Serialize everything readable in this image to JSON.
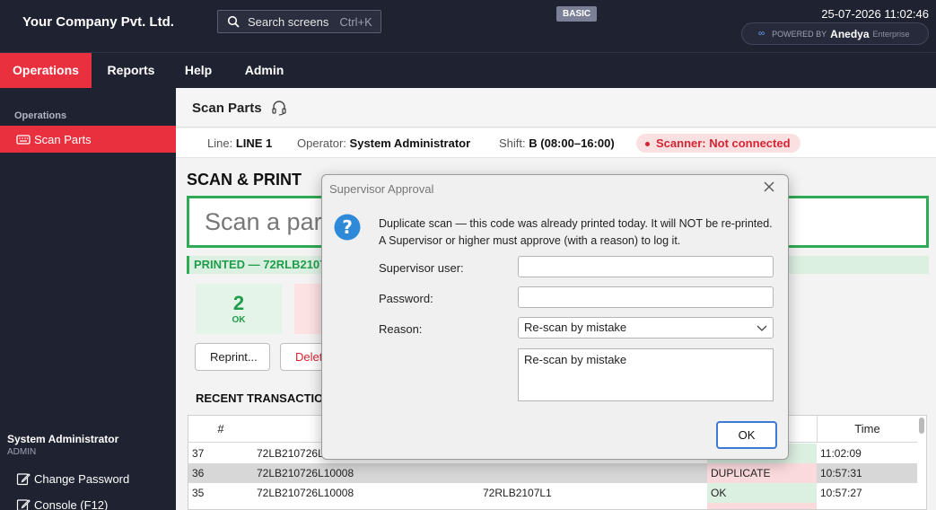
{
  "header": {
    "company": "Your Company Pvt. Ltd.",
    "search_label": "Search screens",
    "search_shortcut": "Ctrl+K",
    "plan_badge": "BASIC",
    "datetime": "25-07-2026 11:02:46",
    "powered_by": "POWERED BY",
    "brand": "Anedya",
    "edition": "Enterprise"
  },
  "menu": {
    "items": [
      "Operations",
      "Reports",
      "Help",
      "Admin"
    ],
    "active": "Operations"
  },
  "sidebar": {
    "section": "Operations",
    "item": "Scan Parts",
    "user_name": "System Administrator",
    "user_role": "ADMIN",
    "change_password": "Change Password",
    "console": "Console (F12)"
  },
  "page": {
    "title": "Scan Parts",
    "line_label": "Line:",
    "line_value": "LINE 1",
    "operator_label": "Operator:",
    "operator_value": "System Administrator",
    "shift_label": "Shift:",
    "shift_value": "B",
    "shift_time": "(08:00–16:00)",
    "scanner_status": "Scanner: Not connected",
    "status_colors": {
      "ok": "#1f9d4b",
      "error": "#d42433",
      "accent": "#e8303e"
    }
  },
  "scan": {
    "section_title": "SCAN & PRINT",
    "input_placeholder": "Scan a part",
    "printed_msg": "PRINTED — 72RLB2107",
    "ok_count": "2",
    "ok_label": "OK",
    "reprint_button": "Reprint...",
    "delete_button": "Delet",
    "recent_title": "RECENT TRANSACTION"
  },
  "table": {
    "headers": {
      "num": "#",
      "time": "Time"
    },
    "rows": [
      {
        "num": "37",
        "code": "72LB210726L",
        "part": "",
        "status": "",
        "time": "11:02:09"
      },
      {
        "num": "36",
        "code": "72LB210726L10008",
        "part": "",
        "status": "DUPLICATE",
        "time": "10:57:31"
      },
      {
        "num": "35",
        "code": "72LB210726L10008",
        "part": "72RLB2107L1",
        "status": "OK",
        "time": "10:57:27"
      }
    ]
  },
  "dialog": {
    "title": "Supervisor Approval",
    "message": "Duplicate scan — this code was already printed today. It will NOT be re-printed. A Supervisor or higher must approve (with a reason) to log it.",
    "supervisor_label": "Supervisor user:",
    "supervisor_value": "",
    "password_label": "Password:",
    "password_value": "",
    "reason_label": "Reason:",
    "reason_selected": "Re-scan by mistake",
    "reason_text": "Re-scan by mistake",
    "ok_button": "OK"
  }
}
